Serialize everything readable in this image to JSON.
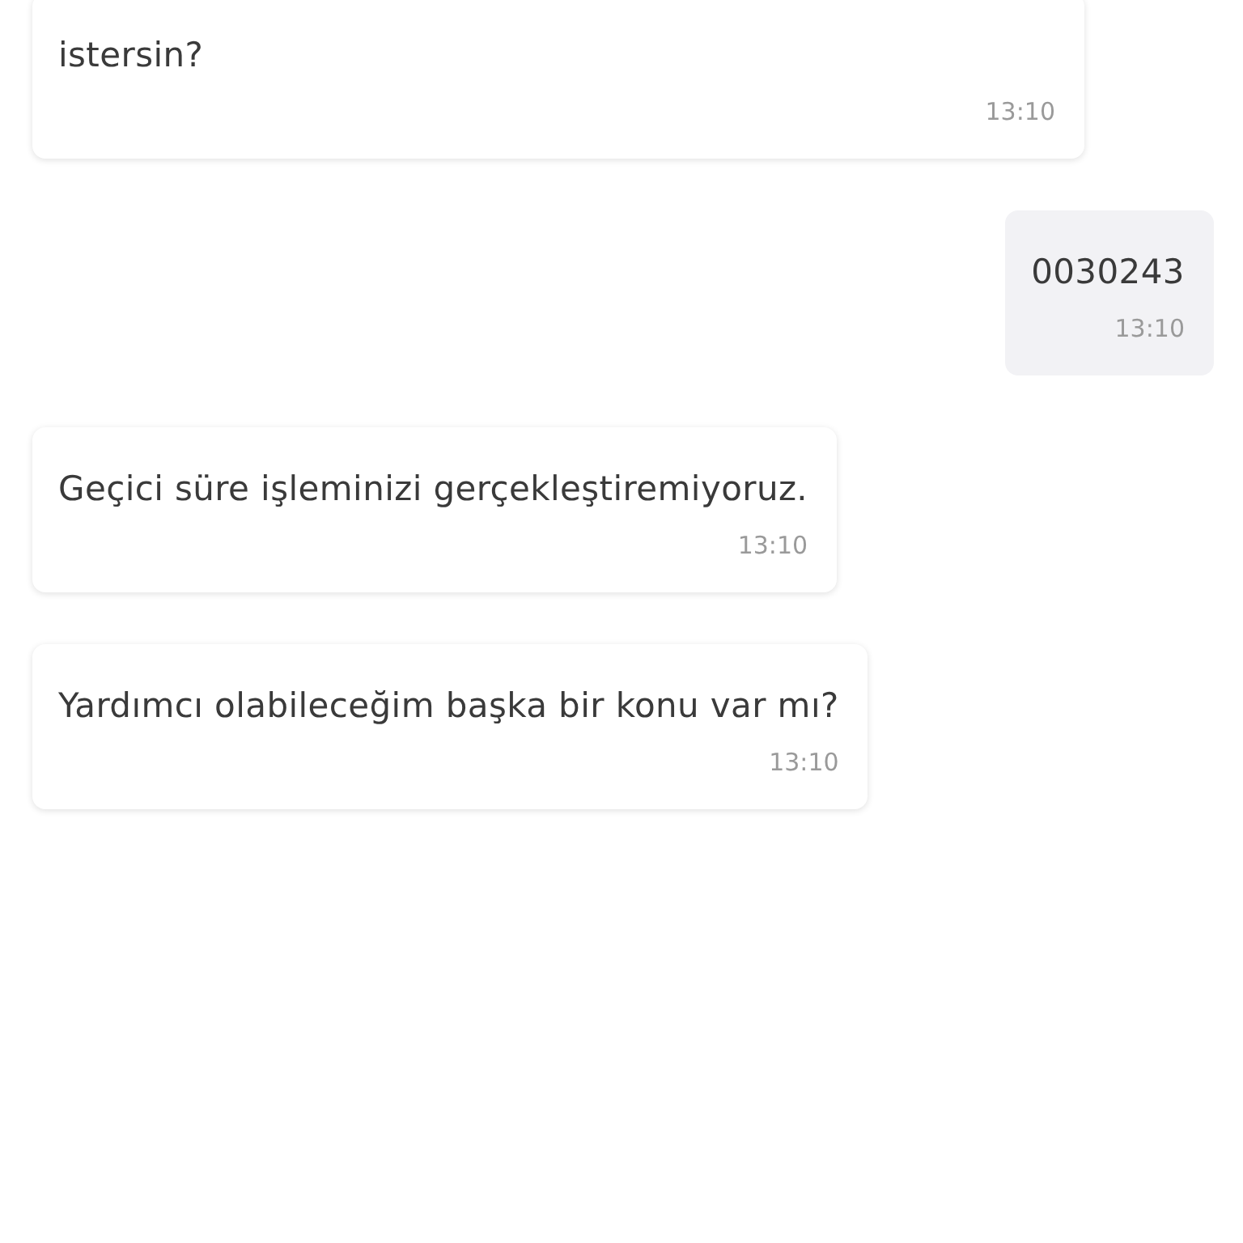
{
  "messages": [
    {
      "kind": "received",
      "text": "istersin?",
      "time": "13:10"
    },
    {
      "kind": "sent",
      "text": "0030243",
      "time": "13:10"
    },
    {
      "kind": "received",
      "text": "Geçici süre işleminizi gerçekleştiremiyoruz.",
      "time": "13:10"
    },
    {
      "kind": "received",
      "text": "Yardımcı olabileceğim başka bir konu var mı?",
      "time": "13:10"
    }
  ]
}
